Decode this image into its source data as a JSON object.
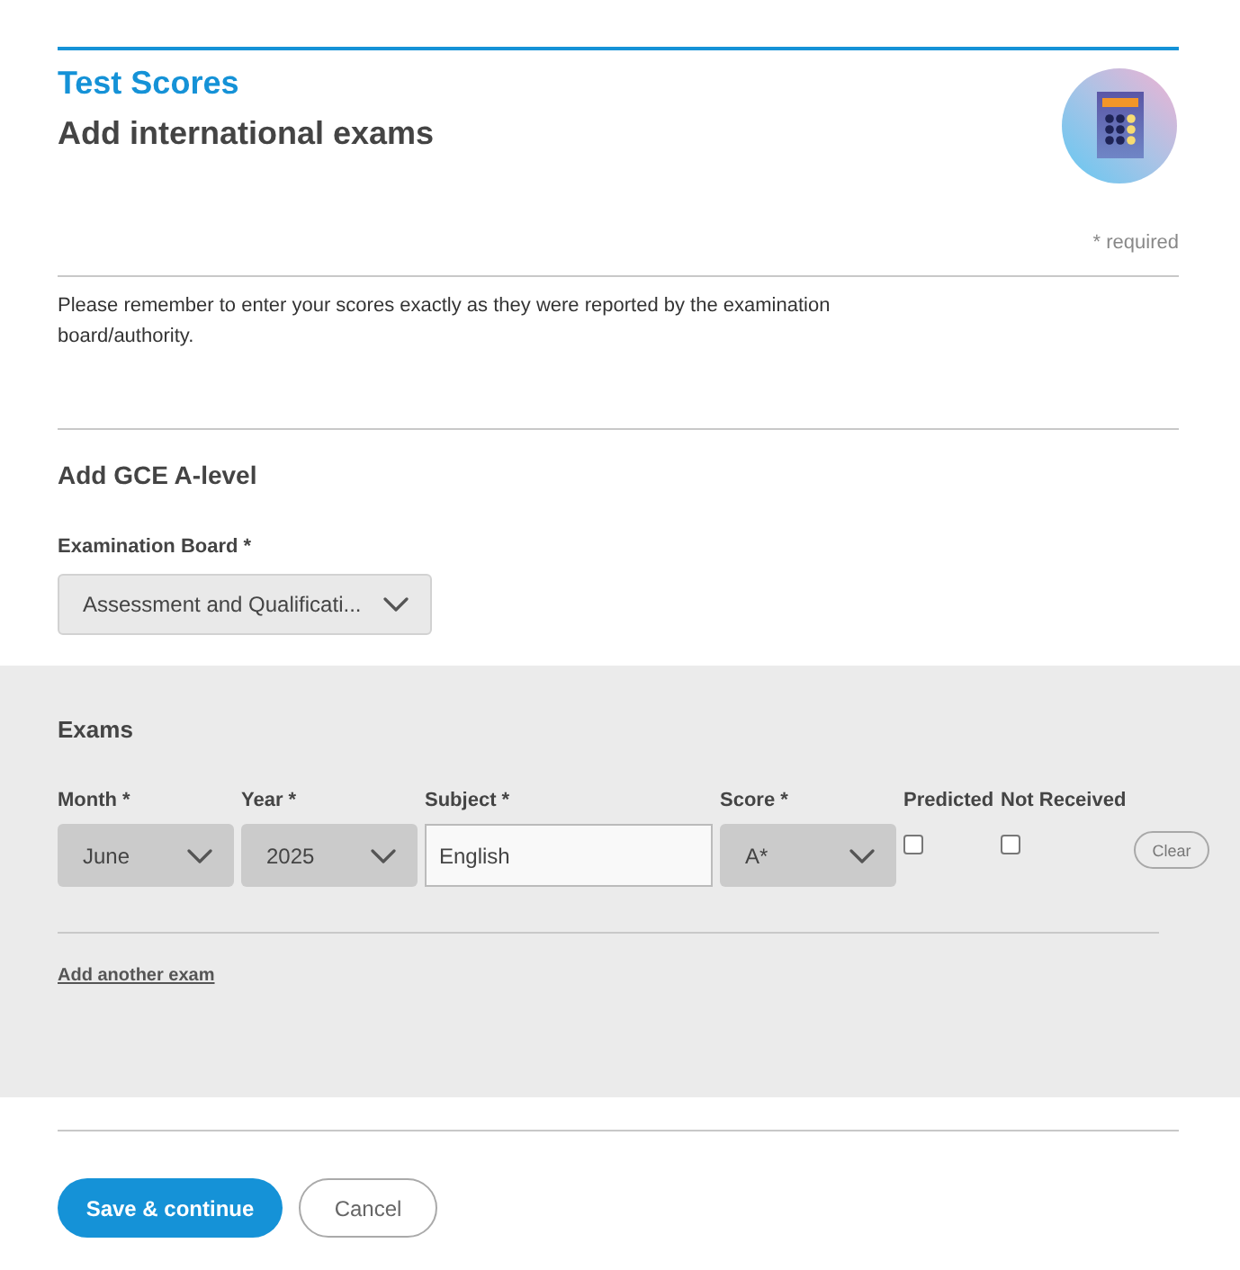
{
  "header": {
    "section": "Test Scores",
    "title": "Add international exams",
    "required_note": "* required"
  },
  "notice": "Please remember to enter your scores exactly as they were reported by the examination board/authority.",
  "gce": {
    "heading": "Add GCE A-level",
    "board": {
      "label": "Examination Board *",
      "value": "Assessment and Qualificati..."
    }
  },
  "exams": {
    "heading": "Exams",
    "columns": [
      "Month *",
      "Year *",
      "Subject *",
      "Score *",
      "Predicted",
      "Not Received"
    ],
    "rows": [
      {
        "month": "June",
        "year": "2025",
        "subject": "English",
        "score": "A*",
        "predicted": false,
        "not_received": false,
        "clear": "Clear"
      }
    ],
    "add_link": "Add another exam"
  },
  "actions": [
    {
      "label": "Save & continue",
      "kind": "primary"
    },
    {
      "label": "Cancel",
      "kind": "secondary"
    }
  ]
}
